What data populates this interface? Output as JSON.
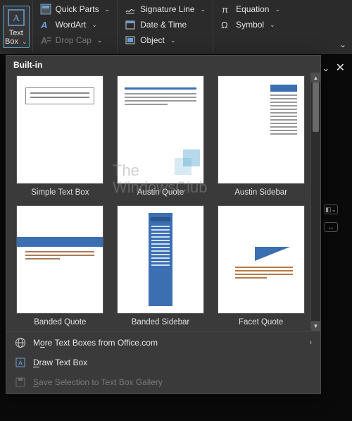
{
  "ribbon": {
    "textbox": {
      "label_line1": "Text",
      "label_line2": "Box"
    },
    "col1": {
      "quickparts": "Quick Parts",
      "wordart": "WordArt",
      "dropcap": "Drop Cap"
    },
    "col2": {
      "sigline": "Signature Line",
      "datetime": "Date & Time",
      "object": "Object"
    },
    "col3": {
      "equation": "Equation",
      "symbol": "Symbol"
    }
  },
  "panel": {
    "header": "Built-in",
    "tiles": [
      {
        "label": "Simple Text Box"
      },
      {
        "label": "Austin Quote"
      },
      {
        "label": "Austin Sidebar"
      },
      {
        "label": "Banded Quote"
      },
      {
        "label": "Banded Sidebar"
      },
      {
        "label": "Facet Quote"
      }
    ],
    "footer": {
      "more_pre": "M",
      "more_ul": "o",
      "more_post": "re Text Boxes from Office.com",
      "draw_ul": "D",
      "draw_post": "raw Text Box",
      "save_ul": "S",
      "save_post": "ave Selection to Text Box Gallery"
    }
  },
  "watermark": {
    "line1": "The",
    "line2": "WindowsClub"
  }
}
